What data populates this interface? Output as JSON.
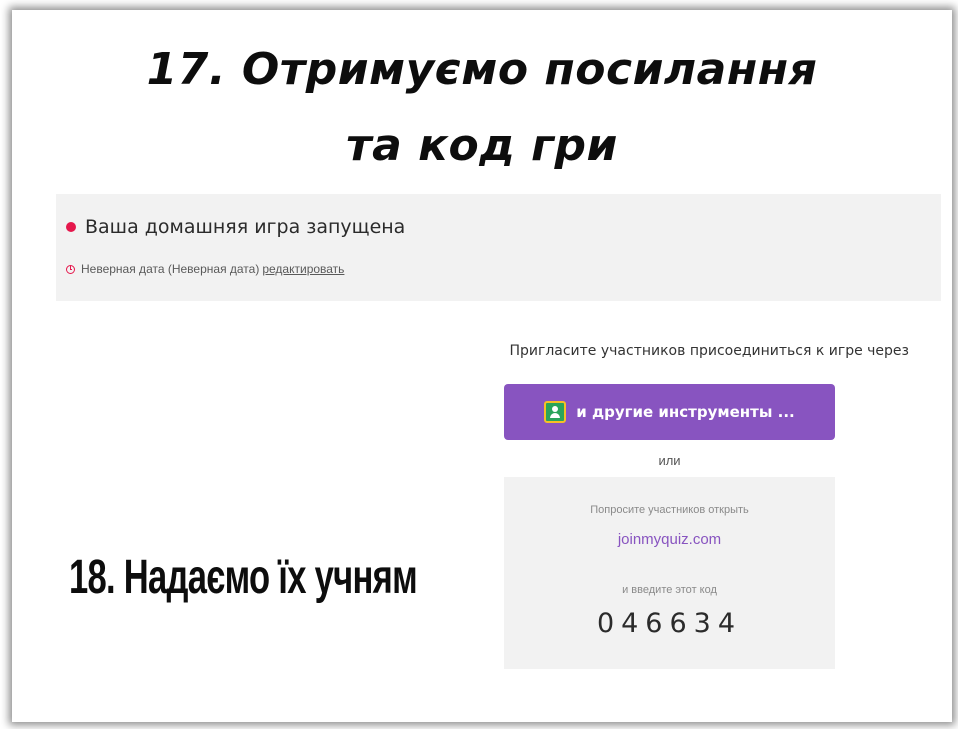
{
  "slide": {
    "heading_line1": "17. Отримуємо посилання",
    "heading_line2": "та код гри",
    "caption": "18. Надаємо їх учням"
  },
  "status": {
    "title": "Ваша домашняя игра запущена",
    "date_text": "Неверная дата (Неверная дата)",
    "edit_label": "редактировать",
    "dot_color": "#e5174c"
  },
  "invite": {
    "prompt": "Пригласите участников присоединиться к игре через",
    "share_button_label": "и другие инструменты ...",
    "share_button_icon": "google-classroom-icon",
    "button_color": "#8854c0",
    "or_label": "или"
  },
  "join_card": {
    "ask_text": "Попросите участников открыть",
    "join_url": "joinmyquiz.com",
    "enter_text": "и введите этот код",
    "game_code": "046634"
  }
}
